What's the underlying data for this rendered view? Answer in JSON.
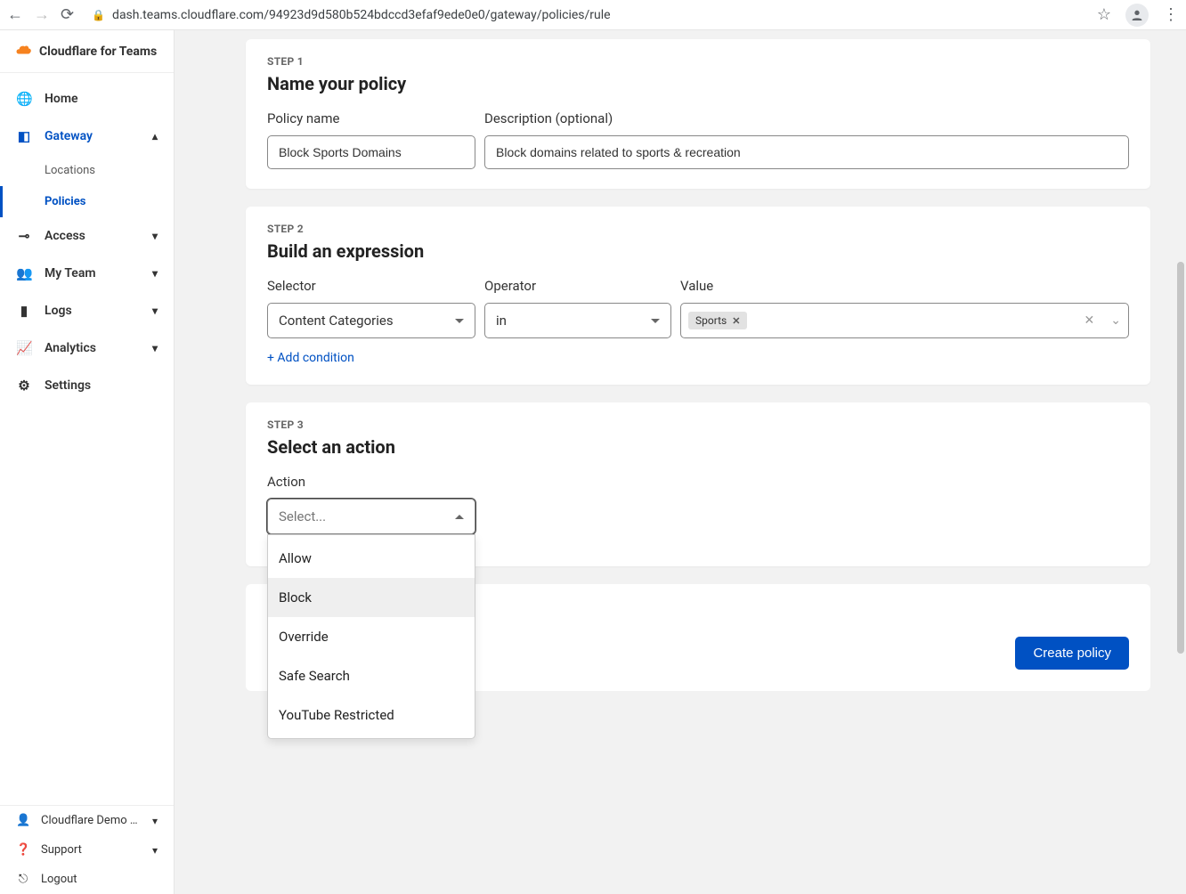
{
  "browser": {
    "url": "dash.teams.cloudflare.com/94923d9d580b524bdccd3efaf9ede0e0/gateway/policies/rule"
  },
  "brand": {
    "name": "Cloudflare for Teams"
  },
  "sidebar": {
    "items": [
      {
        "label": "Home"
      },
      {
        "label": "Gateway",
        "sub": [
          {
            "label": "Locations"
          },
          {
            "label": "Policies"
          }
        ]
      },
      {
        "label": "Access"
      },
      {
        "label": "My Team"
      },
      {
        "label": "Logs"
      },
      {
        "label": "Analytics"
      },
      {
        "label": "Settings"
      }
    ],
    "footer": {
      "account": "Cloudflare Demo d…",
      "support": "Support",
      "logout": "Logout"
    }
  },
  "step1": {
    "label": "STEP 1",
    "title": "Name your policy",
    "name_label": "Policy name",
    "desc_label": "Description (optional)",
    "name_value": "Block Sports Domains",
    "desc_value": "Block domains related to sports & recreation"
  },
  "step2": {
    "label": "STEP 2",
    "title": "Build an expression",
    "selector_label": "Selector",
    "operator_label": "Operator",
    "value_label": "Value",
    "selector_value": "Content Categories",
    "operator_value": "in",
    "tag": "Sports",
    "add_condition": "+ Add condition"
  },
  "step3": {
    "label": "STEP 3",
    "title": "Select an action",
    "action_label": "Action",
    "action_placeholder": "Select...",
    "options": [
      "Allow",
      "Block",
      "Override",
      "Safe Search",
      "YouTube Restricted"
    ]
  },
  "buttons": {
    "create": "Create policy"
  }
}
